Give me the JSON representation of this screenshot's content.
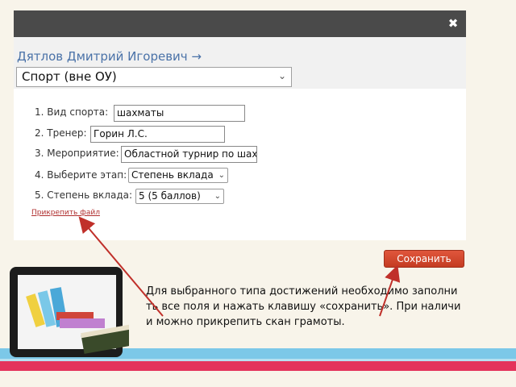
{
  "modal": {
    "close_label": "✖",
    "person_name": "Дятлов Дмитрий Игоревич →",
    "category": {
      "value": "Спорт (вне ОУ)",
      "chevron": "⌄"
    }
  },
  "form": {
    "fields": [
      {
        "label": "1. Вид спорта:",
        "value": "шахматы"
      },
      {
        "label": "2. Тренер:",
        "value": "Горин Л.С."
      },
      {
        "label": "3. Мероприятие:",
        "value": "Областной турнир по шах"
      },
      {
        "label": "4. Выберите этап:",
        "value": "Степень вклада"
      },
      {
        "label": "5. Степень вклада:",
        "value": "5 (5 баллов)"
      }
    ],
    "attach_link": "Прикрепить файл"
  },
  "save_button": "Сохранить",
  "instruction": {
    "line1": "Для выбранного типа достижений необходимо заполни",
    "line2": "ть все поля и нажать клавишу «сохранить». При наличи",
    "line3": "и можно прикрепить скан грамоты."
  },
  "colors": {
    "header": "#4a4a4a",
    "name": "#4a72a8",
    "save": "#d24a30",
    "arrow": "#c0302a",
    "stripe_blue": "#7cc8e8",
    "stripe_red": "#e4335b"
  }
}
